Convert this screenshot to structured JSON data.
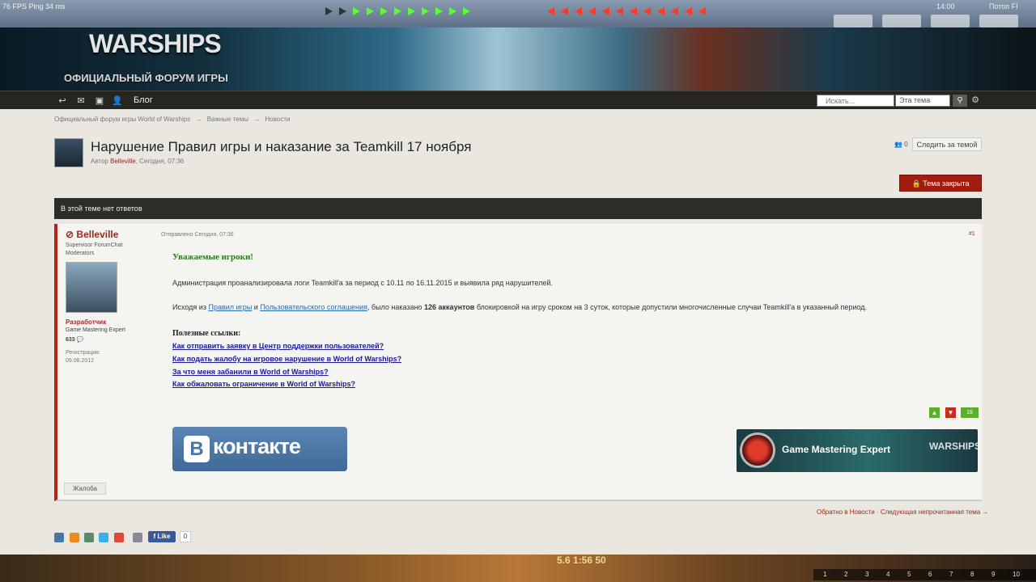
{
  "hud": {
    "fps": "76 FPS  Ping 34 ms",
    "clock": "14:00",
    "login": "Потоп  FI",
    "ally_count": 11,
    "enemy_count": 12,
    "stats": "5.6   1:56   50",
    "keys": [
      "1",
      "2",
      "3",
      "4",
      "5",
      "6",
      "7",
      "8",
      "9",
      "10"
    ]
  },
  "banner": {
    "logo": "WARSHIPS",
    "forum_name": "ОФИЦИАЛЬНЫЙ ФОРУМ ИГРЫ"
  },
  "nav": {
    "blog": "Блог",
    "search_placeholder": "Искать...",
    "search_scope": "Эта тема"
  },
  "breadcrumb": [
    "Официальный форум игры World of Warships",
    "→",
    "Важные темы",
    "→",
    "Новости"
  ],
  "topic": {
    "title": "Нарушение Правил игры и наказание за Teamkill 17 ноября",
    "meta_prefix": "Автор ",
    "author": "Belleville",
    "meta_suffix": ", Сегодня, 07:36",
    "followers": "0",
    "follow_label": "Следить за темой",
    "closed_label": "Тема закрыта",
    "no_replies": "В этой теме нет ответов"
  },
  "post": {
    "author": "Belleville",
    "role": "Supervisor ForumChat Moderators",
    "group": "Разработчик",
    "title": "Game Mastering Expert",
    "posts": "633",
    "reg_label": "Регистрация:",
    "reg_date": "09.08.2012",
    "posted_on": "Отправлено Сегодня, 07:36",
    "number": "#1",
    "greeting": "Уважаемые игроки!",
    "para1": "Администрация проанализировала логи Teamkill'а за период с 10.11 по 16.11.2015 и выявила ряд нарушителей.",
    "para2_a": "Исходя из ",
    "para2_link1": "Правил игры",
    "para2_b": " и ",
    "para2_link2": "Пользовательского соглашения",
    "para2_c": ", было наказано ",
    "para2_bold": "126 аккаунтов",
    "para2_d": " блокировкой на игру сроком на 3 суток, которые допустили  многочисленные случаи Teamkill'а в указанный период.",
    "useful": "Полезные ссылки:",
    "links": [
      "Как отправить заявку в Центр поддержки пользователей?",
      "Как подать жалобу на игровое нарушение в World of Warships?",
      "За что меня забанили в World of Warships?",
      "Как обжаловать ограничение в World of Warships?"
    ],
    "rep": "16",
    "report": "Жалоба",
    "vk_text": "контакте",
    "vk_b": "В",
    "gme_text": "Game Mastering Expert",
    "gme_wows": "WARSHIPS"
  },
  "footer": {
    "back": "Обратно в Новости · Следующая непрочитанная тема →",
    "fb_like": "Like",
    "fb_count": "0"
  },
  "colors": {
    "accent_red": "#b3261e",
    "link_blue": "#1a1a9a",
    "greeting_green": "#2a7a1a"
  }
}
